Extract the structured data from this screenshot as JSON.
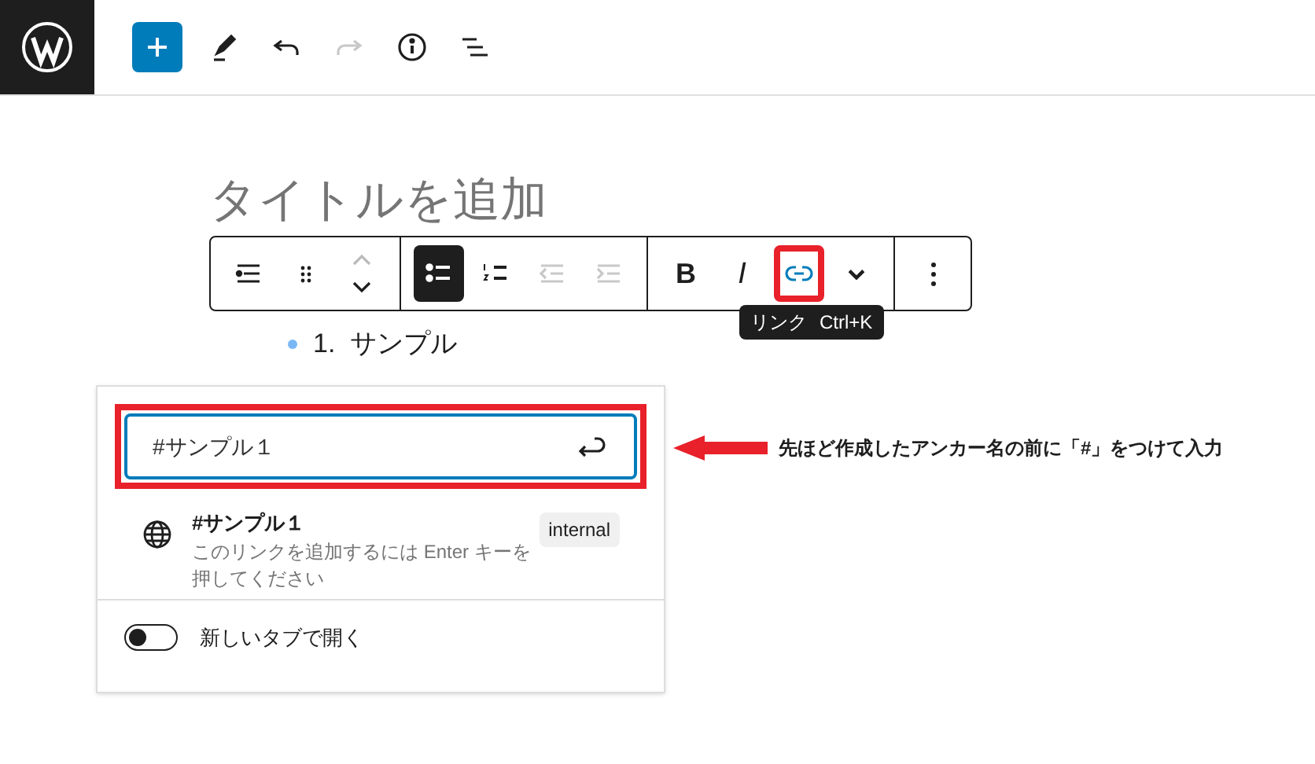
{
  "header": {
    "tools": [
      {
        "kind": "inserter",
        "disabled": false
      },
      {
        "kind": "pen",
        "disabled": false
      },
      {
        "kind": "undo",
        "disabled": false
      },
      {
        "kind": "redo",
        "disabled": true
      },
      {
        "kind": "info",
        "disabled": false
      },
      {
        "kind": "outline",
        "disabled": false
      }
    ]
  },
  "editor": {
    "title_placeholder": "タイトルを追加",
    "list_item": "1.  サンプル"
  },
  "toolbar": {
    "groups": [
      [
        {
          "kind": "list-lines",
          "selected": false,
          "disabled": false
        },
        {
          "kind": "drag",
          "selected": false,
          "disabled": false
        },
        {
          "kind": "move",
          "selected": false,
          "disabled": false
        }
      ],
      [
        {
          "kind": "bullets",
          "selected": true,
          "disabled": false
        },
        {
          "kind": "numbers",
          "selected": false,
          "disabled": false
        },
        {
          "kind": "outdent",
          "selected": false,
          "disabled": true
        },
        {
          "kind": "indent",
          "selected": false,
          "disabled": true
        }
      ],
      [
        {
          "kind": "bold",
          "label": "B",
          "selected": false,
          "disabled": false
        },
        {
          "kind": "italic",
          "label": "I",
          "selected": false,
          "disabled": false
        },
        {
          "kind": "link",
          "selected": true,
          "disabled": false
        },
        {
          "kind": "chevron",
          "selected": false,
          "disabled": false
        }
      ],
      [
        {
          "kind": "more",
          "selected": false,
          "disabled": false
        }
      ]
    ]
  },
  "tooltip": {
    "label": "リンク",
    "shortcut": "Ctrl+K"
  },
  "link_popover": {
    "value": "#サンプル１",
    "suggestion": {
      "title": "#サンプル１",
      "hint": "このリンクを追加するには Enter キーを押してください",
      "badge": "internal"
    },
    "new_tab": {
      "label": "新しいタブで開く",
      "on": false
    }
  },
  "annotation": {
    "text": "先ほど作成したアンカー名の前に「#」をつけて入力"
  }
}
